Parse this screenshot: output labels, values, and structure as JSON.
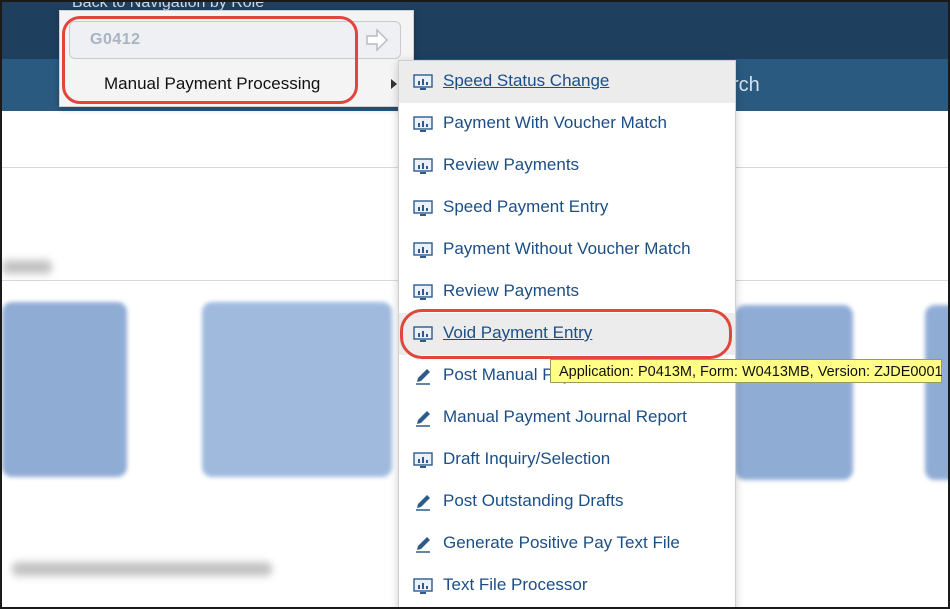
{
  "header": {
    "back_link": "Back to Navigation by Role",
    "search_partial": "rch"
  },
  "role_popup": {
    "task_code": "G0412",
    "menu_label": "Manual Payment Processing"
  },
  "submenu": {
    "items": [
      {
        "label": "Speed Status Change",
        "icon": "app-monitor-icon"
      },
      {
        "label": "Payment With Voucher Match",
        "icon": "app-monitor-icon"
      },
      {
        "label": "Review Payments",
        "icon": "app-monitor-icon"
      },
      {
        "label": "Speed Payment Entry",
        "icon": "app-monitor-icon"
      },
      {
        "label": "Payment Without Voucher Match",
        "icon": "app-monitor-icon"
      },
      {
        "label": "Review Payments",
        "icon": "app-monitor-icon"
      },
      {
        "label": "Void Payment Entry",
        "icon": "app-monitor-icon"
      },
      {
        "label": "Post Manual Payments",
        "icon": "report-pencil-icon"
      },
      {
        "label": "Manual Payment Journal Report",
        "icon": "report-pencil-icon"
      },
      {
        "label": "Draft Inquiry/Selection",
        "icon": "app-monitor-icon"
      },
      {
        "label": "Post Outstanding Drafts",
        "icon": "report-pencil-icon"
      },
      {
        "label": "Generate Positive Pay Text File",
        "icon": "report-pencil-icon"
      },
      {
        "label": "Text File Processor",
        "icon": "app-monitor-icon"
      }
    ]
  },
  "tooltip": {
    "text": "Application: P0413M, Form: W0413MB, Version: ZJDE0001"
  },
  "colors": {
    "highlight": "#e0463c",
    "link": "#1c4e86",
    "tooltip_bg": "#ffff88"
  }
}
